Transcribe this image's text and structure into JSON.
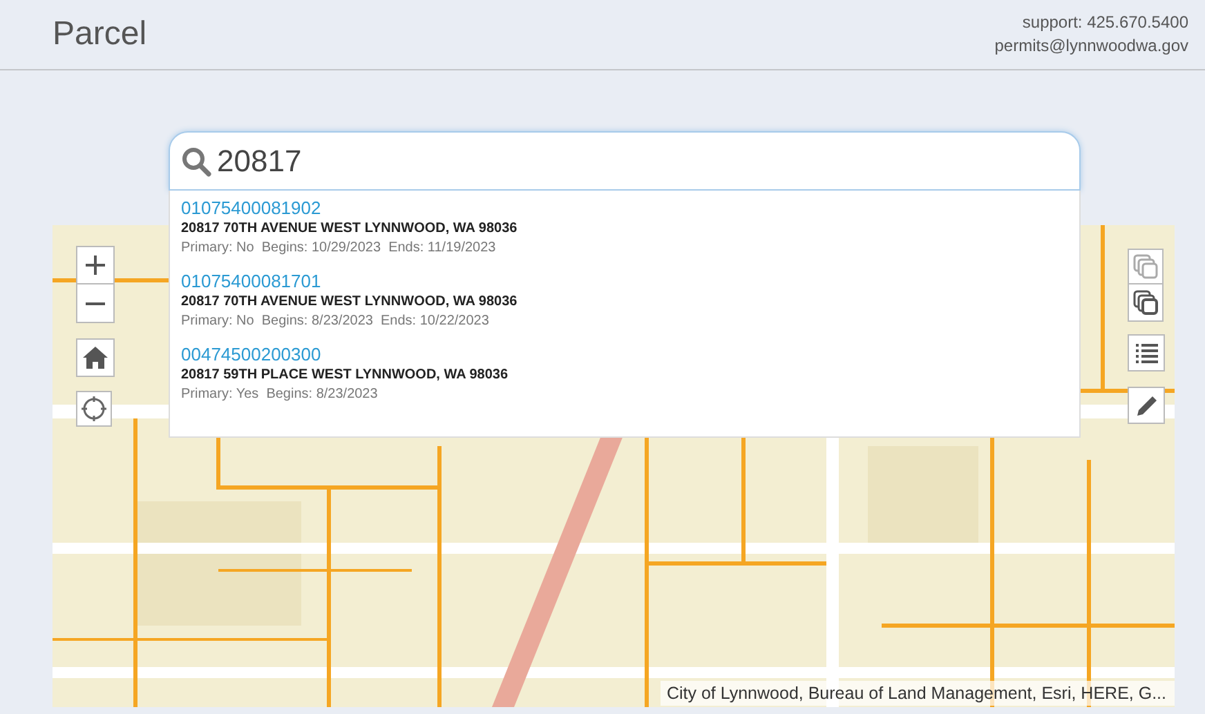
{
  "header": {
    "title": "Parcel",
    "support": "support: 425.670.5400",
    "email": "permits@lynnwoodwa.gov"
  },
  "search": {
    "value": "20817"
  },
  "results": [
    {
      "parcel_id": "01075400081902",
      "address": "20817 70TH AVENUE WEST LYNNWOOD, WA 98036",
      "details": [
        {
          "label": "Primary:",
          "value": "No"
        },
        {
          "label": "Begins:",
          "value": "10/29/2023"
        },
        {
          "label": "Ends:",
          "value": "11/19/2023"
        }
      ]
    },
    {
      "parcel_id": "01075400081701",
      "address": "20817 70TH AVENUE WEST LYNNWOOD, WA 98036",
      "details": [
        {
          "label": "Primary:",
          "value": "No"
        },
        {
          "label": "Begins:",
          "value": "8/23/2023"
        },
        {
          "label": "Ends:",
          "value": "10/22/2023"
        }
      ]
    },
    {
      "parcel_id": "00474500200300",
      "address": "20817 59TH PLACE WEST LYNNWOOD, WA 98036",
      "details": [
        {
          "label": "Primary:",
          "value": "Yes"
        },
        {
          "label": "Begins:",
          "value": "8/23/2023"
        }
      ]
    }
  ],
  "map": {
    "attribution": "City of Lynnwood, Bureau of Land Management, Esri, HERE, G..."
  }
}
